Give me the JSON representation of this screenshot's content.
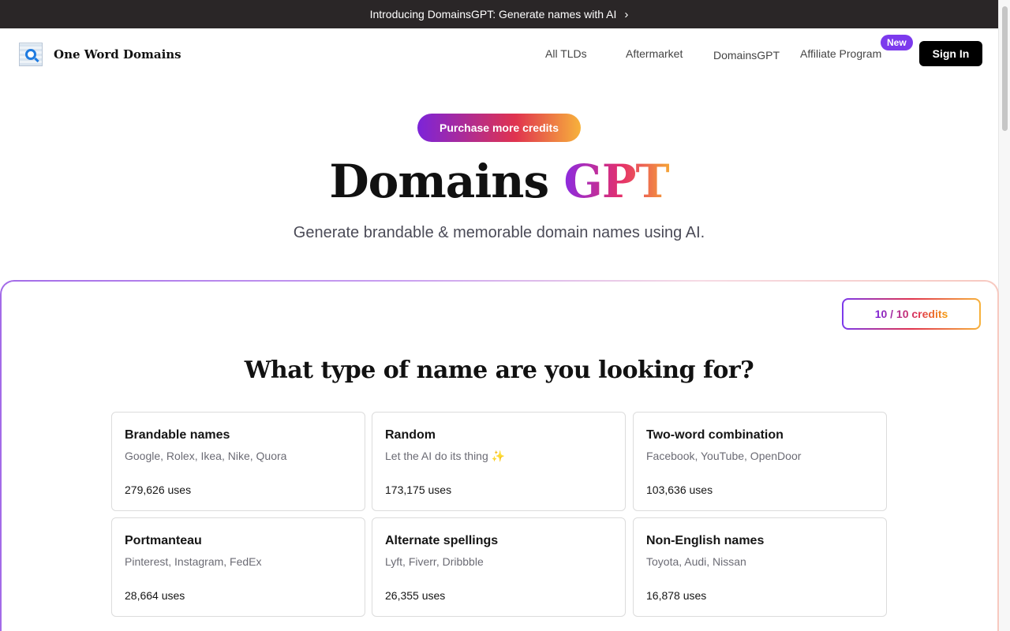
{
  "announcement": {
    "text": "Introducing DomainsGPT: Generate names with AI",
    "chevron": "›"
  },
  "nav": {
    "brand": "One Word Domains",
    "links": [
      "All TLDs",
      "Aftermarket",
      "DomainsGPT",
      "Affiliate Program"
    ],
    "new_badge": "New",
    "sign_in": "Sign In"
  },
  "hero": {
    "purchase_button": "Purchase more credits",
    "title_main": "Domains",
    "title_accent": "GPT",
    "subtitle": "Generate brandable & memorable domain names using AI."
  },
  "panel": {
    "credits": "10 / 10 credits",
    "question": "What type of name are you looking for?",
    "cards": [
      {
        "title": "Brandable names",
        "desc": "Google, Rolex, Ikea, Nike, Quora",
        "uses": "279,626 uses"
      },
      {
        "title": "Random",
        "desc": "Let the AI do its thing ✨",
        "uses": "173,175 uses"
      },
      {
        "title": "Two-word combination",
        "desc": "Facebook, YouTube, OpenDoor",
        "uses": "103,636 uses"
      },
      {
        "title": "Portmanteau",
        "desc": "Pinterest, Instagram, FedEx",
        "uses": "28,664 uses"
      },
      {
        "title": "Alternate spellings",
        "desc": "Lyft, Fiverr, Dribbble",
        "uses": "26,355 uses"
      },
      {
        "title": "Non-English names",
        "desc": "Toyota, Audi, Nissan",
        "uses": "16,878 uses"
      }
    ]
  },
  "colors": {
    "accent_purple": "#7c3aed",
    "accent_pink": "#e0334f",
    "accent_orange": "#f7b23b",
    "announce_bg": "#2a2627"
  }
}
